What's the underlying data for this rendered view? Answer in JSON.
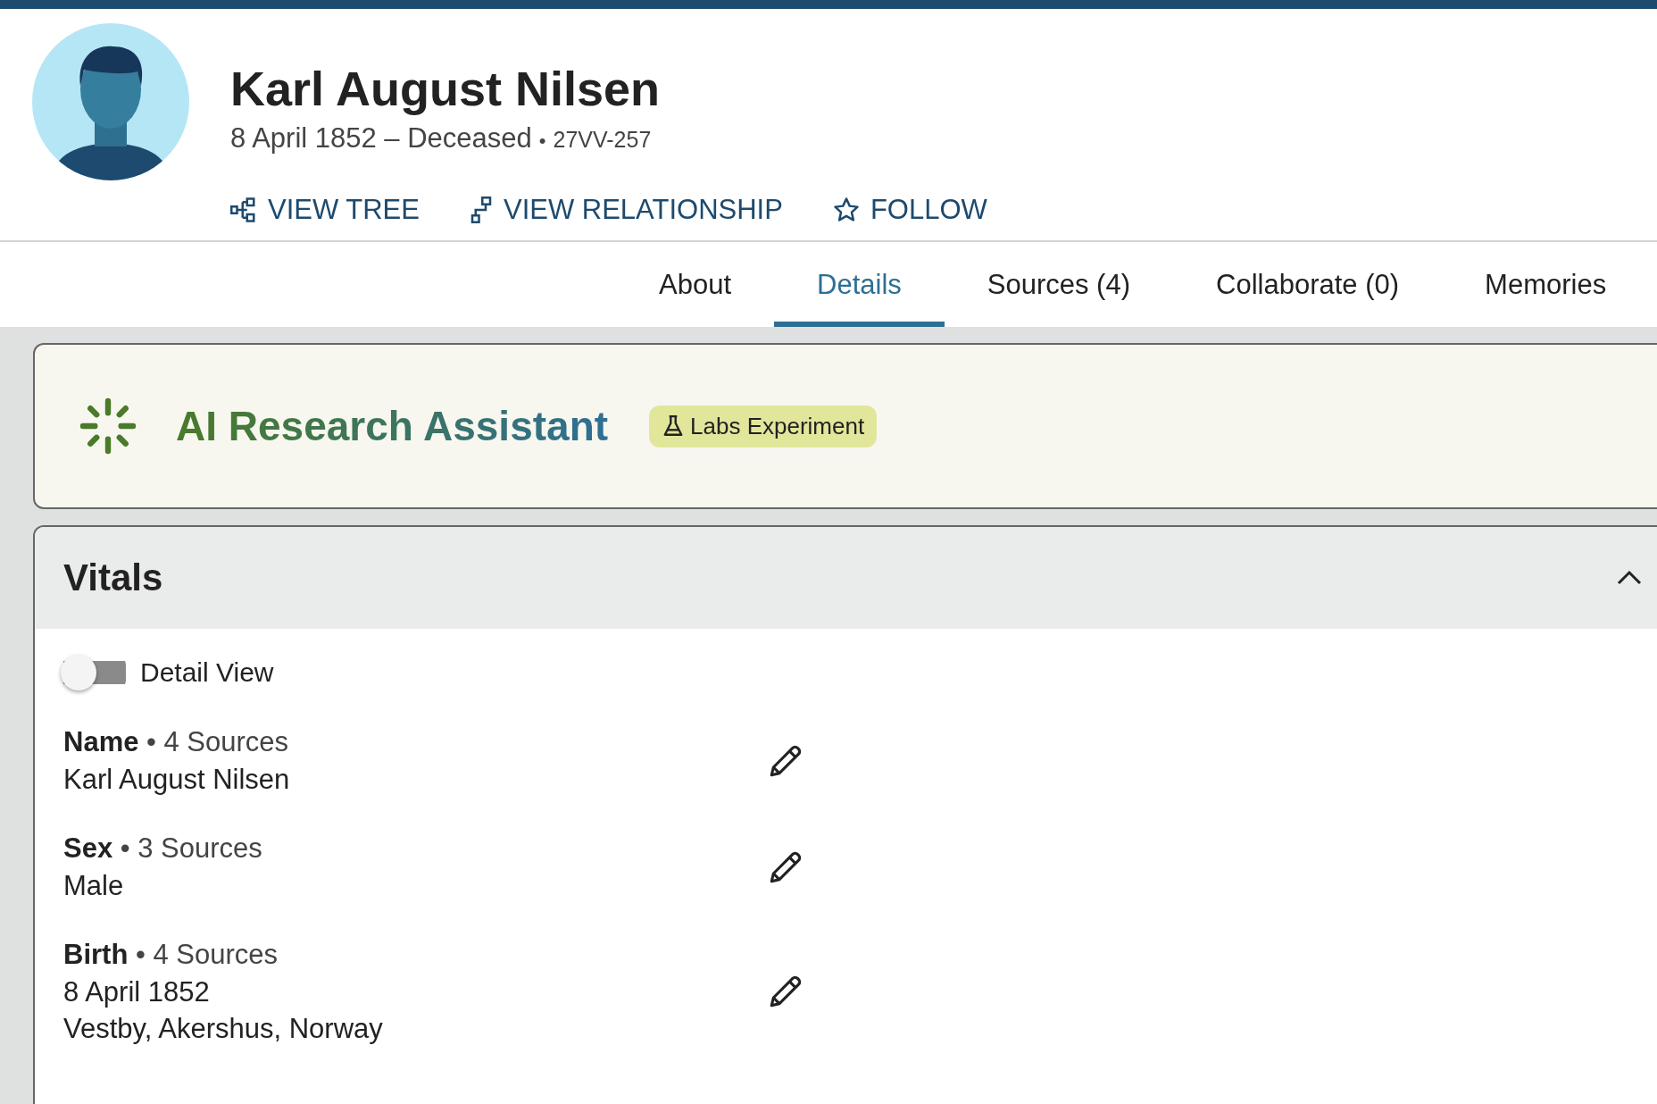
{
  "person": {
    "name": "Karl August Nilsen",
    "lifespan": "8 April 1852 – Deceased",
    "separator": "•",
    "id": "27VV-257"
  },
  "actions": [
    {
      "kind": "tree",
      "label": "VIEW TREE"
    },
    {
      "kind": "relationship",
      "label": "VIEW RELATIONSHIP"
    },
    {
      "kind": "follow",
      "label": "FOLLOW"
    }
  ],
  "tabs": [
    {
      "label": "About",
      "selected": false
    },
    {
      "label": "Details",
      "selected": true
    },
    {
      "label": "Sources (4)",
      "selected": false
    },
    {
      "label": "Collaborate (0)",
      "selected": false
    },
    {
      "label": "Memories",
      "selected": false
    }
  ],
  "assistant": {
    "title": "AI Research Assistant",
    "badge": "Labs Experiment"
  },
  "vitals": {
    "title": "Vitals",
    "expanded": true,
    "detail_view": {
      "label": "Detail View",
      "on": false
    },
    "facts": [
      {
        "heading": "**Name** • 4 Sources",
        "values": [
          "Karl August Nilsen"
        ]
      },
      {
        "heading": "**Sex** • 3 Sources",
        "values": [
          "Male"
        ]
      },
      {
        "heading": "**Birth** • 4 Sources",
        "values": [
          "8 April 1852",
          "Vestby, Akershus, Norway"
        ]
      }
    ]
  }
}
